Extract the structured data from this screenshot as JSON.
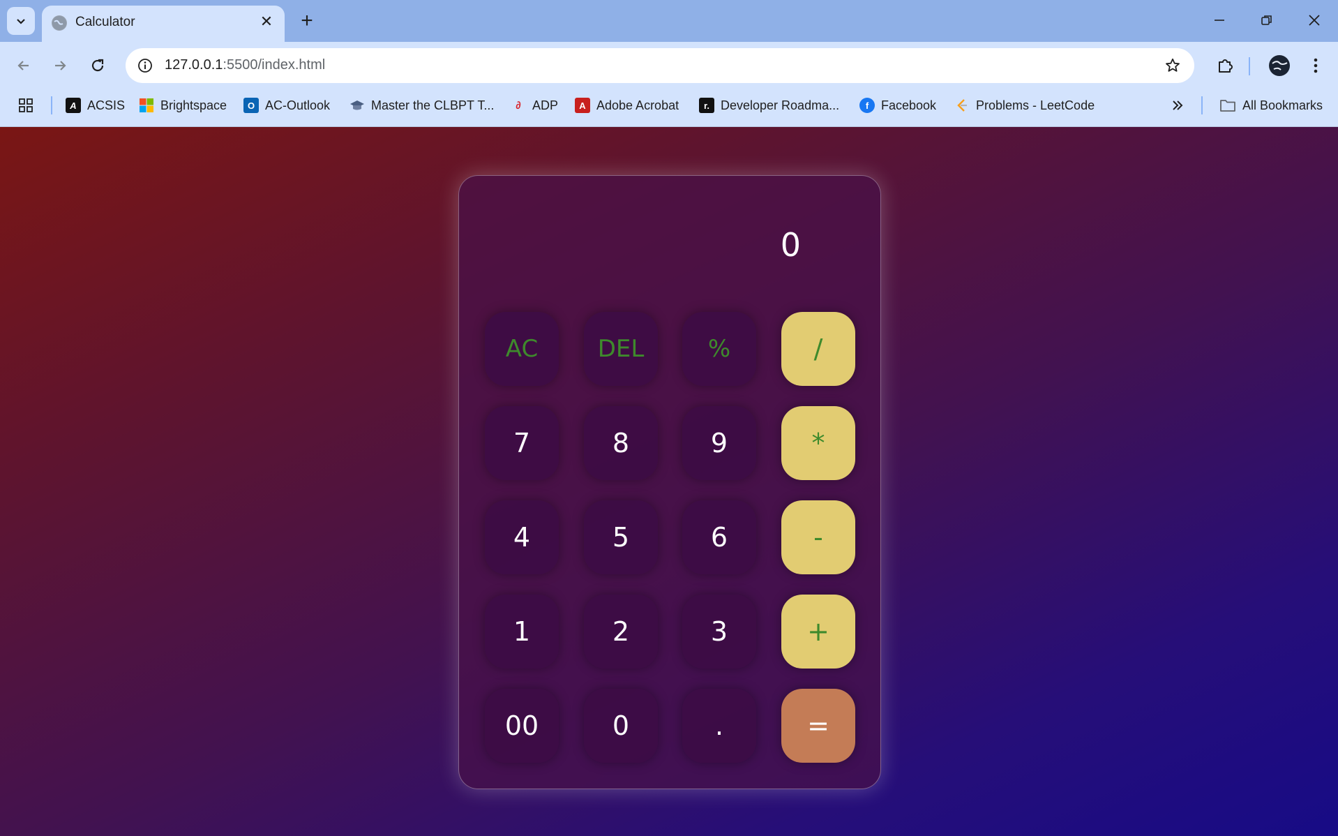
{
  "browser": {
    "tab_title": "Calculator",
    "url_host": "127.0.0.1",
    "url_rest": ":5500/index.html",
    "bookmarks": [
      {
        "label": "ACSIS",
        "icon": "acsis-icon",
        "color": "#111111"
      },
      {
        "label": "Brightspace",
        "icon": "brightspace-icon",
        "color": "#f25022"
      },
      {
        "label": "AC-Outlook",
        "icon": "outlook-icon",
        "color": "#0a64b4"
      },
      {
        "label": "Master the CLBPT T...",
        "icon": "graduation-cap-icon",
        "color": "#5a6b85"
      },
      {
        "label": "ADP",
        "icon": "adp-icon",
        "color": "#d8262e"
      },
      {
        "label": "Adobe Acrobat",
        "icon": "acrobat-icon",
        "color": "#c8201e"
      },
      {
        "label": "Developer Roadma...",
        "icon": "roadmap-icon",
        "color": "#111111"
      },
      {
        "label": "Facebook",
        "icon": "facebook-icon",
        "color": "#1877f2"
      },
      {
        "label": "Problems - LeetCode",
        "icon": "leetcode-icon",
        "color": "#f89f1b"
      }
    ],
    "all_bookmarks": "All Bookmarks"
  },
  "calculator": {
    "display": "0",
    "keys": [
      {
        "label": "AC",
        "kind": "func",
        "name": "clear-all-button"
      },
      {
        "label": "DEL",
        "kind": "func",
        "name": "delete-button"
      },
      {
        "label": "%",
        "kind": "func",
        "name": "percent-button"
      },
      {
        "label": "/",
        "kind": "op",
        "name": "divide-button"
      },
      {
        "label": "7",
        "kind": "num",
        "name": "digit-7-button"
      },
      {
        "label": "8",
        "kind": "num",
        "name": "digit-8-button"
      },
      {
        "label": "9",
        "kind": "num",
        "name": "digit-9-button"
      },
      {
        "label": "*",
        "kind": "op",
        "name": "multiply-button"
      },
      {
        "label": "4",
        "kind": "num",
        "name": "digit-4-button"
      },
      {
        "label": "5",
        "kind": "num",
        "name": "digit-5-button"
      },
      {
        "label": "6",
        "kind": "num",
        "name": "digit-6-button"
      },
      {
        "label": "-",
        "kind": "op",
        "name": "subtract-button"
      },
      {
        "label": "1",
        "kind": "num",
        "name": "digit-1-button"
      },
      {
        "label": "2",
        "kind": "num",
        "name": "digit-2-button"
      },
      {
        "label": "3",
        "kind": "num",
        "name": "digit-3-button"
      },
      {
        "label": "+",
        "kind": "op",
        "name": "add-button"
      },
      {
        "label": "00",
        "kind": "num",
        "name": "double-zero-button"
      },
      {
        "label": "0",
        "kind": "num",
        "name": "digit-0-button"
      },
      {
        "label": ".",
        "kind": "num",
        "name": "decimal-button"
      },
      {
        "label": "=",
        "kind": "eq",
        "name": "equals-button"
      }
    ]
  }
}
